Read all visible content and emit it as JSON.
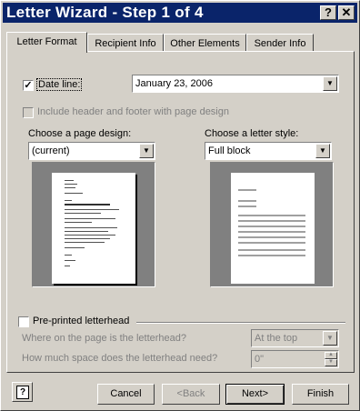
{
  "window": {
    "title": "Letter Wizard - Step 1 of 4",
    "help_glyph": "?",
    "close_glyph": "✕"
  },
  "tabs": [
    {
      "label": "Letter Format",
      "active": true
    },
    {
      "label": "Recipient Info",
      "active": false
    },
    {
      "label": "Other Elements",
      "active": false
    },
    {
      "label": "Sender Info",
      "active": false
    }
  ],
  "date_line": {
    "checked": true,
    "label": "Date line:",
    "value": "January 23, 2006"
  },
  "header_footer": {
    "label": "Include header and footer with page design",
    "checked": false,
    "enabled": false
  },
  "page_design": {
    "label": "Choose a page design:",
    "value": "(current)"
  },
  "letter_style": {
    "label": "Choose a letter style:",
    "value": "Full block"
  },
  "letterhead": {
    "label": "Pre-printed letterhead",
    "checked": false,
    "where_label": "Where on the page is the letterhead?",
    "where_value": "At the top",
    "space_label": "How much space does the letterhead need?",
    "space_value": "0\""
  },
  "buttons": {
    "help_glyph": "?",
    "cancel": "Cancel",
    "back": "<Back",
    "next": "Next>",
    "finish": "Finish"
  }
}
